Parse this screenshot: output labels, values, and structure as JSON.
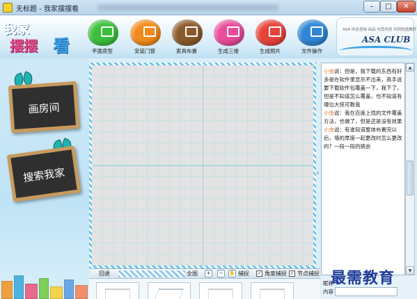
{
  "window": {
    "title": "无标题 - 我家摆摆看",
    "minimize": "–",
    "maximize": "□",
    "close": "✕"
  },
  "logo": {
    "line1": "我家",
    "line2": "摆摆",
    "line3": "看"
  },
  "toolbar": {
    "items": [
      {
        "label": "平面房型",
        "color": "#3cbf3c",
        "icon": "floorplan-icon"
      },
      {
        "label": "安装门窗",
        "color": "#f28a1c",
        "icon": "door-window-icon"
      },
      {
        "label": "家具布置",
        "color": "#8a5a2b",
        "icon": "furniture-icon"
      },
      {
        "label": "生成三维",
        "color": "#e84c9a",
        "icon": "cube-icon"
      },
      {
        "label": "生成照片",
        "color": "#e8433a",
        "icon": "camera-icon"
      },
      {
        "label": "文件操作",
        "color": "#2f86d6",
        "icon": "wrench-icon"
      }
    ]
  },
  "brand": {
    "small": "ASA 中达咨询 出品 与您共创 共同创造美好 ASA设计",
    "name": "ASA CLUB"
  },
  "left": {
    "draw_room": "画房间",
    "search_home": "搜索我家"
  },
  "canvas_toolbar": {
    "undo": "回退",
    "fullscreen": "全图",
    "zoom_in": "+",
    "zoom_out": "−",
    "capture": "捕捉",
    "angle_capture": "角度捕捉",
    "node_capture": "节点捕捉"
  },
  "chat": {
    "messages": [
      {
        "nick": "小虫",
        "text": "说：但是，我下载的东西有好多是在软件里显示不出来，高手说要下载软件包覆盖一下，我下了，但是不知道怎么覆盖，也不知道有哪位大侠可教我"
      },
      {
        "nick": "小虫",
        "text": "说：我在百度上找的文件覆盖方法，也做了，但是还是没有效果"
      },
      {
        "nick": "小虫",
        "text": "说：有谁知道整体布置完以后，墙的厚度一起更改时怎么更改的？一段一段的搞会"
      }
    ],
    "nick_label": "昵称",
    "content_label": "内容"
  },
  "watermark": "最需教育",
  "colors": {
    "accent": "#2b8ad6",
    "chat_nick": "#e0701c",
    "grid_bg": "#e3e3e3"
  }
}
